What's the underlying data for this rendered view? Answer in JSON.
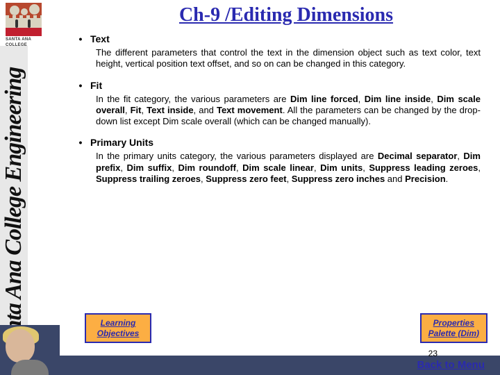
{
  "sidebar": {
    "college_label_line1": "SANTA ANA",
    "college_label_line2": "COLLEGE",
    "banner_text": "Santa Ana College Engineering"
  },
  "title": "Ch-9 /Editing Dimensions",
  "sections": [
    {
      "heading": "Text",
      "body_segments": [
        {
          "t": "The different parameters that control the text in the dimension object such as text color, text height, vertical position text offset, and so on can be changed in this category.",
          "b": false
        }
      ]
    },
    {
      "heading": "Fit",
      "body_segments": [
        {
          "t": "In the fit category, the various parameters are ",
          "b": false
        },
        {
          "t": "Dim line forced",
          "b": true
        },
        {
          "t": ", ",
          "b": false
        },
        {
          "t": "Dim line inside",
          "b": true
        },
        {
          "t": ", ",
          "b": false
        },
        {
          "t": "Dim scale overall",
          "b": true
        },
        {
          "t": ", ",
          "b": false
        },
        {
          "t": "Fit",
          "b": true
        },
        {
          "t": ", ",
          "b": false
        },
        {
          "t": "Text inside",
          "b": true
        },
        {
          "t": ", and ",
          "b": false
        },
        {
          "t": "Text movement",
          "b": true
        },
        {
          "t": ". All the parameters can be changed by the drop-down list except Dim scale overall (which can be changed manually).",
          "b": false
        }
      ]
    },
    {
      "heading": "Primary Units",
      "body_segments": [
        {
          "t": "In the primary units category, the various parameters displayed are ",
          "b": false
        },
        {
          "t": "Decimal separator",
          "b": true
        },
        {
          "t": ", ",
          "b": false
        },
        {
          "t": "Dim prefix",
          "b": true
        },
        {
          "t": ", ",
          "b": false
        },
        {
          "t": "Dim suffix",
          "b": true
        },
        {
          "t": ", ",
          "b": false
        },
        {
          "t": "Dim roundoff",
          "b": true
        },
        {
          "t": ", ",
          "b": false
        },
        {
          "t": "Dim scale linear",
          "b": true
        },
        {
          "t": ", ",
          "b": false
        },
        {
          "t": "Dim units",
          "b": true
        },
        {
          "t": ", ",
          "b": false
        },
        {
          "t": "Suppress leading zeroes",
          "b": true
        },
        {
          "t": ", ",
          "b": false
        },
        {
          "t": "Suppress trailing zeroes",
          "b": true
        },
        {
          "t": ", ",
          "b": false
        },
        {
          "t": "Suppress zero feet",
          "b": true
        },
        {
          "t": ", ",
          "b": false
        },
        {
          "t": "Suppress zero inches",
          "b": true
        },
        {
          "t": " and ",
          "b": false
        },
        {
          "t": "Precision",
          "b": true
        },
        {
          "t": ".",
          "b": false
        }
      ]
    }
  ],
  "nav": {
    "left_line1": "Learning",
    "left_line2": "Objectives",
    "right_line1": "Properties",
    "right_line2": "Palette (Dim)"
  },
  "page_number": "23",
  "back_link": "Back to Menu"
}
